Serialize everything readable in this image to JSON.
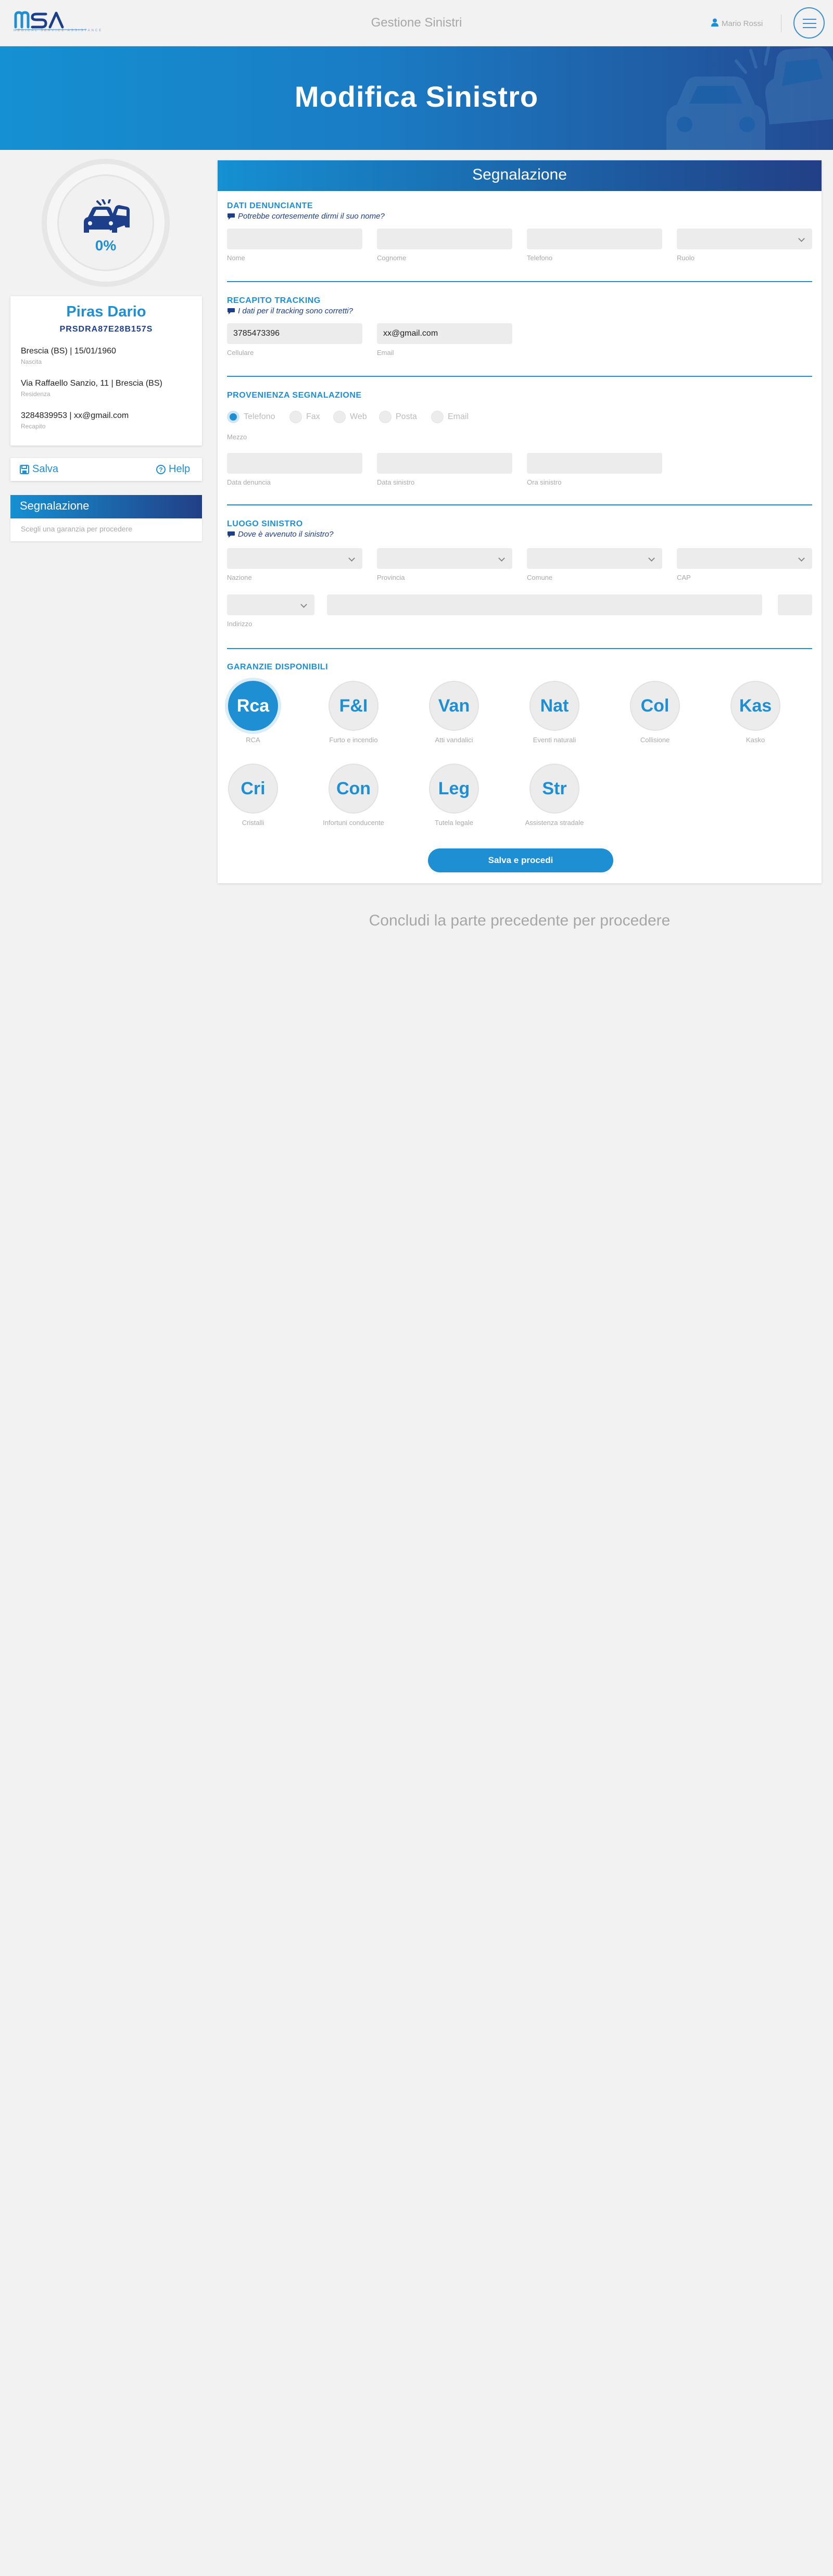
{
  "header": {
    "logo": "MSA",
    "logo_sub": "MEDICAL SERVICE ASSISTANCE",
    "title": "Gestione Sinistri",
    "user": "Mario Rossi",
    "icons": {
      "user": "user-icon",
      "menu": "hamburger-menu-icon"
    }
  },
  "hero": {
    "title": "Modifica Sinistro"
  },
  "progress": {
    "percent": "0%",
    "value": 0,
    "icon": "car-crash-icon"
  },
  "person": {
    "name": "Piras Dario",
    "cf": "PRSDRA87E28B157S",
    "birth": "Brescia (BS) | 15/01/1960",
    "birth_label": "Nascita",
    "residence": "Via Raffaello Sanzio, 11 | Brescia (BS)",
    "residence_label": "Residenza",
    "contact": "3284839953 | xx@gmail.com",
    "contact_label": "Recapito"
  },
  "actions": {
    "save": "Salva",
    "help": "Help"
  },
  "steps": {
    "title": "Segnalazione",
    "hint": "Scegli una garanzia per procedere"
  },
  "form": {
    "title": "Segnalazione",
    "denunciante": {
      "title": "DATI DENUNCIANTE",
      "subtitle": "Potrebbe cortesemente dirmi il suo nome?",
      "labels": [
        "Nome",
        "Cognome",
        "Telefono",
        "Ruolo"
      ],
      "values": [
        "",
        "",
        "",
        ""
      ]
    },
    "tracking": {
      "title": "RECAPITO TRACKING",
      "subtitle": "I dati per il tracking sono corretti?",
      "labels": [
        "Cellulare",
        "Email"
      ],
      "values": [
        "3785473396",
        "xx@gmail.com"
      ]
    },
    "provenienza": {
      "title": "PROVENIENZA SEGNALAZIONE",
      "options": [
        "Telefono",
        "Fax",
        "Web",
        "Posta",
        "Email"
      ],
      "selected": "Telefono",
      "mezzo_label": "Mezzo",
      "labels": [
        "Data denuncia",
        "Data sinistro",
        "Ora sinistro"
      ]
    },
    "luogo": {
      "title": "LUOGO SINISTRO",
      "subtitle": "Dove è avvenuto il sinistro?",
      "labels": [
        "Nazione",
        "Provincia",
        "Comune",
        "CAP"
      ],
      "indirizzo_label": "Indirizzo"
    },
    "garanzie": {
      "title": "GARANZIE DISPONIBILI",
      "items": [
        {
          "code": "Rca",
          "label": "RCA",
          "active": true
        },
        {
          "code": "F&I",
          "label": "Furto e incendio",
          "active": false
        },
        {
          "code": "Van",
          "label": "Atti vandalici",
          "active": false
        },
        {
          "code": "Nat",
          "label": "Eventi naturali",
          "active": false
        },
        {
          "code": "Col",
          "label": "Collisione",
          "active": false
        },
        {
          "code": "Kas",
          "label": "Kasko",
          "active": false
        },
        {
          "code": "Cri",
          "label": "Cristalli",
          "active": false
        },
        {
          "code": "Con",
          "label": "Infortuni conducente",
          "active": false
        },
        {
          "code": "Leg",
          "label": "Tutela legale",
          "active": false
        },
        {
          "code": "Str",
          "label": "Assistenza stradale",
          "active": false
        }
      ]
    },
    "submit": "Salva e procedi"
  },
  "footer_hint": "Concludi la parte precedente per procedere",
  "colors": {
    "primary": "#1f8fd3",
    "dark": "#223f86",
    "background": "#f2f2f2"
  }
}
